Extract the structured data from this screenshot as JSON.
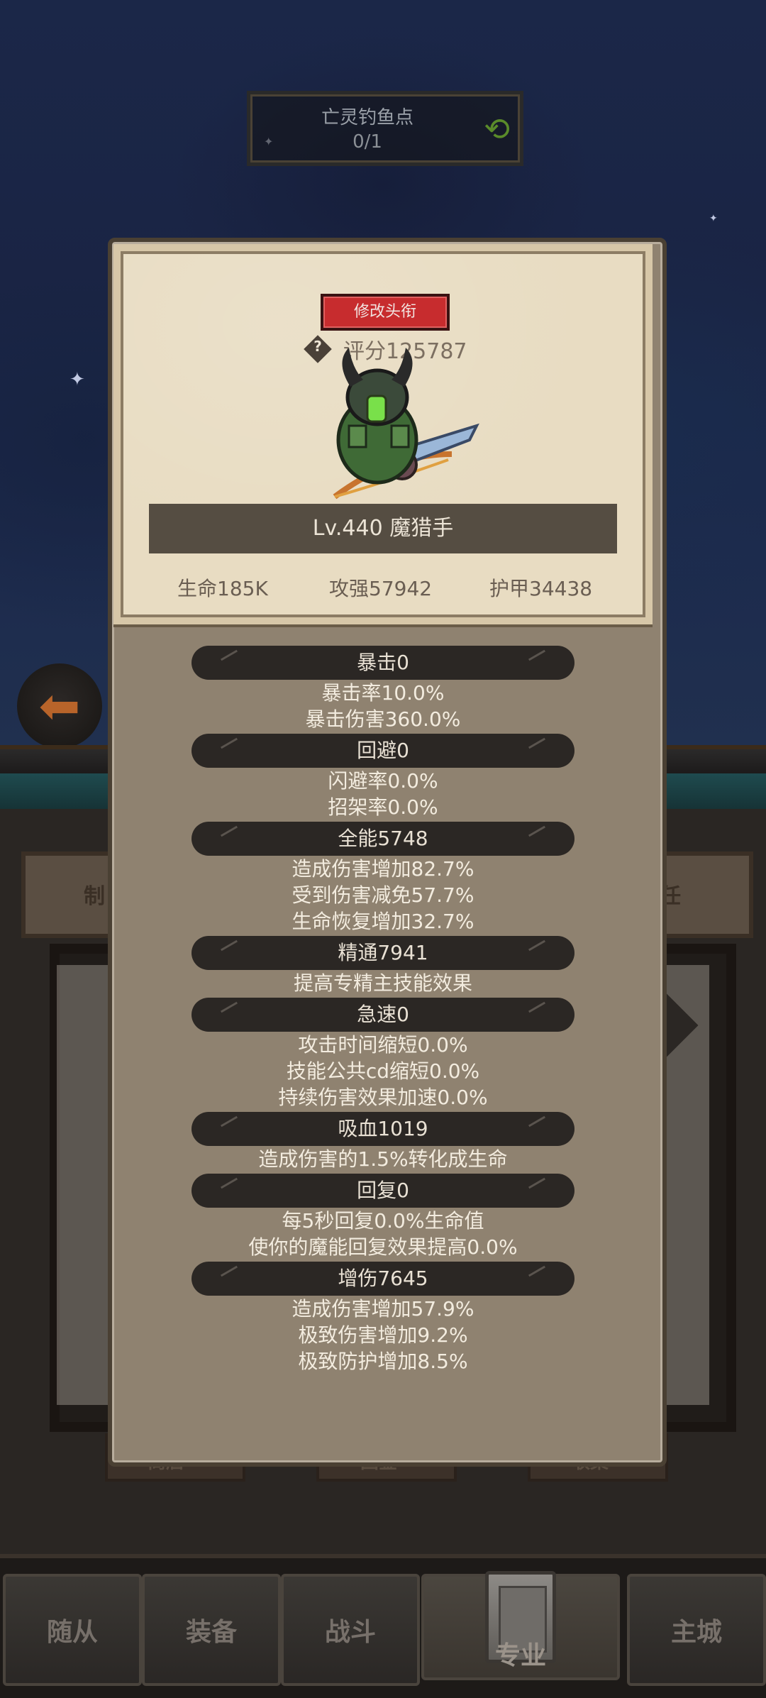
{
  "location": {
    "name": "亡灵钓鱼点",
    "count": "0/1"
  },
  "bg_tabs": {
    "left": "制",
    "right": "任",
    "t1": "商店",
    "t2": "国金",
    "t3": "收集"
  },
  "profile": {
    "title_button": "修改头衔",
    "help": "?",
    "score": "评分125787",
    "level": "Lv.440 魔猎手",
    "stats": {
      "hp": "生命185K",
      "atk": "攻强57942",
      "armor": "护甲34438"
    }
  },
  "attributes": [
    {
      "header": "暴击0",
      "lines": [
        "暴击率10.0%",
        "暴击伤害360.0%"
      ]
    },
    {
      "header": "回避0",
      "lines": [
        "闪避率0.0%",
        "招架率0.0%"
      ]
    },
    {
      "header": "全能5748",
      "lines": [
        "造成伤害增加82.7%",
        "受到伤害减免57.7%",
        "生命恢复增加32.7%"
      ]
    },
    {
      "header": "精通7941",
      "lines": [
        "提高专精主技能效果"
      ]
    },
    {
      "header": "急速0",
      "lines": [
        "攻击时间缩短0.0%",
        "技能公共cd缩短0.0%",
        "持续伤害效果加速0.0%"
      ]
    },
    {
      "header": "吸血1019",
      "lines": [
        "造成伤害的1.5%转化成生命"
      ]
    },
    {
      "header": "回复0",
      "lines": [
        "每5秒回复0.0%生命值",
        "使你的魔能回复效果提高0.0%"
      ]
    },
    {
      "header": "增伤7645",
      "lines": [
        "造成伤害增加57.9%",
        "极致伤害增加9.2%",
        "极致防护增加8.5%"
      ]
    }
  ],
  "nav": {
    "items": [
      {
        "label": "随从"
      },
      {
        "label": "装备"
      },
      {
        "label": "战斗"
      },
      {
        "label": "专业"
      },
      {
        "label": "主城"
      }
    ],
    "active_index": 3
  },
  "colors": {
    "accent_red": "#c72c2e",
    "panel": "#8f8270",
    "parchment": "#e8dcc2"
  },
  "icons": [
    "swap-arrows-icon",
    "back-arrow-icon",
    "help-icon",
    "profession-book-icon"
  ]
}
